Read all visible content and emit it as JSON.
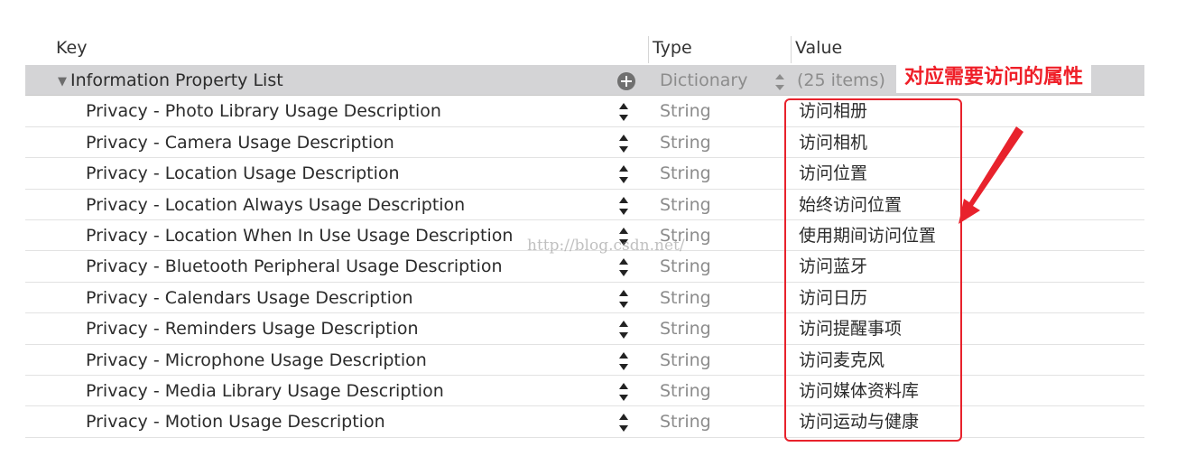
{
  "columns": {
    "key": "Key",
    "type": "Type",
    "value": "Value"
  },
  "root": {
    "key": "Information Property List",
    "type": "Dictionary",
    "value": "(25 items)"
  },
  "rows": [
    {
      "key": "Privacy - Photo Library Usage Description",
      "type": "String",
      "value": "访问相册"
    },
    {
      "key": "Privacy - Camera Usage Description",
      "type": "String",
      "value": "访问相机"
    },
    {
      "key": "Privacy - Location Usage Description",
      "type": "String",
      "value": "访问位置"
    },
    {
      "key": "Privacy - Location Always Usage Description",
      "type": "String",
      "value": "始终访问位置"
    },
    {
      "key": "Privacy - Location When In Use Usage Description",
      "type": "String",
      "value": "使用期间访问位置"
    },
    {
      "key": "Privacy - Bluetooth Peripheral Usage Description",
      "type": "String",
      "value": "访问蓝牙"
    },
    {
      "key": "Privacy - Calendars Usage Description",
      "type": "String",
      "value": "访问日历"
    },
    {
      "key": "Privacy - Reminders Usage Description",
      "type": "String",
      "value": "访问提醒事项"
    },
    {
      "key": "Privacy - Microphone Usage Description",
      "type": "String",
      "value": "访问麦克风"
    },
    {
      "key": "Privacy - Media Library Usage Description",
      "type": "String",
      "value": "访问媒体资料库"
    },
    {
      "key": "Privacy - Motion Usage Description",
      "type": "String",
      "value": "访问运动与健康"
    }
  ],
  "annotation": {
    "label": "对应需要访问的属性",
    "color": "#ef1f28"
  },
  "watermark": "http://blog.csdn.net/"
}
